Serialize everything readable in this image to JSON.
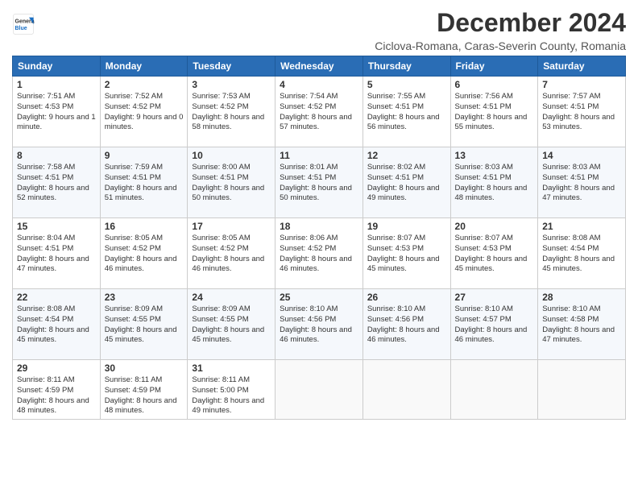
{
  "header": {
    "logo_line1": "General",
    "logo_line2": "Blue",
    "title": "December 2024",
    "subtitle": "Ciclova-Romana, Caras-Severin County, Romania"
  },
  "days_of_week": [
    "Sunday",
    "Monday",
    "Tuesday",
    "Wednesday",
    "Thursday",
    "Friday",
    "Saturday"
  ],
  "weeks": [
    [
      {
        "day": "1",
        "sunrise": "7:51 AM",
        "sunset": "4:53 PM",
        "daylight": "9 hours and 1 minute."
      },
      {
        "day": "2",
        "sunrise": "7:52 AM",
        "sunset": "4:52 PM",
        "daylight": "9 hours and 0 minutes."
      },
      {
        "day": "3",
        "sunrise": "7:53 AM",
        "sunset": "4:52 PM",
        "daylight": "8 hours and 58 minutes."
      },
      {
        "day": "4",
        "sunrise": "7:54 AM",
        "sunset": "4:52 PM",
        "daylight": "8 hours and 57 minutes."
      },
      {
        "day": "5",
        "sunrise": "7:55 AM",
        "sunset": "4:51 PM",
        "daylight": "8 hours and 56 minutes."
      },
      {
        "day": "6",
        "sunrise": "7:56 AM",
        "sunset": "4:51 PM",
        "daylight": "8 hours and 55 minutes."
      },
      {
        "day": "7",
        "sunrise": "7:57 AM",
        "sunset": "4:51 PM",
        "daylight": "8 hours and 53 minutes."
      }
    ],
    [
      {
        "day": "8",
        "sunrise": "7:58 AM",
        "sunset": "4:51 PM",
        "daylight": "8 hours and 52 minutes."
      },
      {
        "day": "9",
        "sunrise": "7:59 AM",
        "sunset": "4:51 PM",
        "daylight": "8 hours and 51 minutes."
      },
      {
        "day": "10",
        "sunrise": "8:00 AM",
        "sunset": "4:51 PM",
        "daylight": "8 hours and 50 minutes."
      },
      {
        "day": "11",
        "sunrise": "8:01 AM",
        "sunset": "4:51 PM",
        "daylight": "8 hours and 50 minutes."
      },
      {
        "day": "12",
        "sunrise": "8:02 AM",
        "sunset": "4:51 PM",
        "daylight": "8 hours and 49 minutes."
      },
      {
        "day": "13",
        "sunrise": "8:03 AM",
        "sunset": "4:51 PM",
        "daylight": "8 hours and 48 minutes."
      },
      {
        "day": "14",
        "sunrise": "8:03 AM",
        "sunset": "4:51 PM",
        "daylight": "8 hours and 47 minutes."
      }
    ],
    [
      {
        "day": "15",
        "sunrise": "8:04 AM",
        "sunset": "4:51 PM",
        "daylight": "8 hours and 47 minutes."
      },
      {
        "day": "16",
        "sunrise": "8:05 AM",
        "sunset": "4:52 PM",
        "daylight": "8 hours and 46 minutes."
      },
      {
        "day": "17",
        "sunrise": "8:05 AM",
        "sunset": "4:52 PM",
        "daylight": "8 hours and 46 minutes."
      },
      {
        "day": "18",
        "sunrise": "8:06 AM",
        "sunset": "4:52 PM",
        "daylight": "8 hours and 46 minutes."
      },
      {
        "day": "19",
        "sunrise": "8:07 AM",
        "sunset": "4:53 PM",
        "daylight": "8 hours and 45 minutes."
      },
      {
        "day": "20",
        "sunrise": "8:07 AM",
        "sunset": "4:53 PM",
        "daylight": "8 hours and 45 minutes."
      },
      {
        "day": "21",
        "sunrise": "8:08 AM",
        "sunset": "4:54 PM",
        "daylight": "8 hours and 45 minutes."
      }
    ],
    [
      {
        "day": "22",
        "sunrise": "8:08 AM",
        "sunset": "4:54 PM",
        "daylight": "8 hours and 45 minutes."
      },
      {
        "day": "23",
        "sunrise": "8:09 AM",
        "sunset": "4:55 PM",
        "daylight": "8 hours and 45 minutes."
      },
      {
        "day": "24",
        "sunrise": "8:09 AM",
        "sunset": "4:55 PM",
        "daylight": "8 hours and 45 minutes."
      },
      {
        "day": "25",
        "sunrise": "8:10 AM",
        "sunset": "4:56 PM",
        "daylight": "8 hours and 46 minutes."
      },
      {
        "day": "26",
        "sunrise": "8:10 AM",
        "sunset": "4:56 PM",
        "daylight": "8 hours and 46 minutes."
      },
      {
        "day": "27",
        "sunrise": "8:10 AM",
        "sunset": "4:57 PM",
        "daylight": "8 hours and 46 minutes."
      },
      {
        "day": "28",
        "sunrise": "8:10 AM",
        "sunset": "4:58 PM",
        "daylight": "8 hours and 47 minutes."
      }
    ],
    [
      {
        "day": "29",
        "sunrise": "8:11 AM",
        "sunset": "4:59 PM",
        "daylight": "8 hours and 48 minutes."
      },
      {
        "day": "30",
        "sunrise": "8:11 AM",
        "sunset": "4:59 PM",
        "daylight": "8 hours and 48 minutes."
      },
      {
        "day": "31",
        "sunrise": "8:11 AM",
        "sunset": "5:00 PM",
        "daylight": "8 hours and 49 minutes."
      },
      null,
      null,
      null,
      null
    ]
  ]
}
